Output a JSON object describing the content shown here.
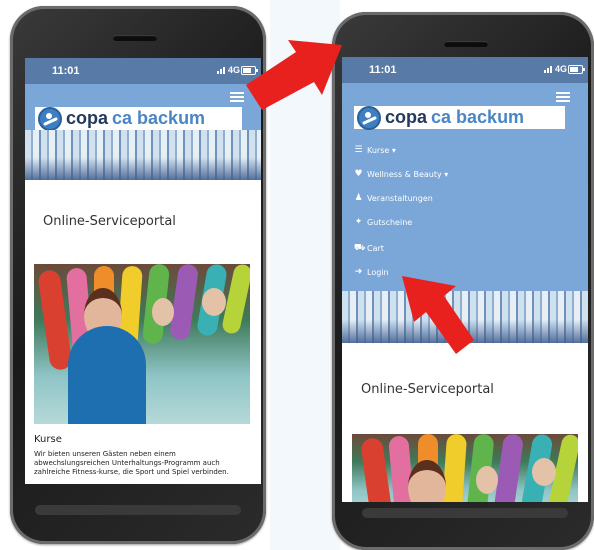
{
  "left_phone": {
    "status_time": "11:01",
    "status_network": "4G",
    "logo_word1": "copa",
    "logo_word2": "ca backum",
    "portal_title": "Online-Serviceportal",
    "card_title": "Kurse",
    "card_text": "Wir bieten unseren Gästen neben einem abwechslungsreichen Unterhaltungs-Programm auch zahlreiche Fitness-kurse, die Sport und Spiel verbinden."
  },
  "right_phone": {
    "status_time": "11:01",
    "status_network": "4G",
    "logo_word1": "copa",
    "logo_word2": "ca backum",
    "menu": [
      {
        "label": "Kurse ▾",
        "icon": "list-icon"
      },
      {
        "label": "Wellness & Beauty ▾",
        "icon": "heart-icon"
      },
      {
        "label": "Veranstaltungen",
        "icon": "people-icon"
      },
      {
        "label": "Gutscheine",
        "icon": "puzzle-icon"
      },
      {
        "label": "Cart",
        "icon": "cart-icon"
      },
      {
        "label": "Login",
        "icon": "sign-in-icon"
      }
    ],
    "portal_title": "Online-Serviceportal"
  },
  "annotations": [
    {
      "name": "arrow-to-hamburger",
      "color": "#e8211f"
    },
    {
      "name": "arrow-to-login",
      "color": "#e8211f"
    }
  ],
  "colors": {
    "header_blue": "#7aa6d8",
    "status_blue": "#587aa6",
    "logo_dark": "#233a5e",
    "logo_light": "#4a86c5",
    "arrow_red": "#e8211f"
  }
}
